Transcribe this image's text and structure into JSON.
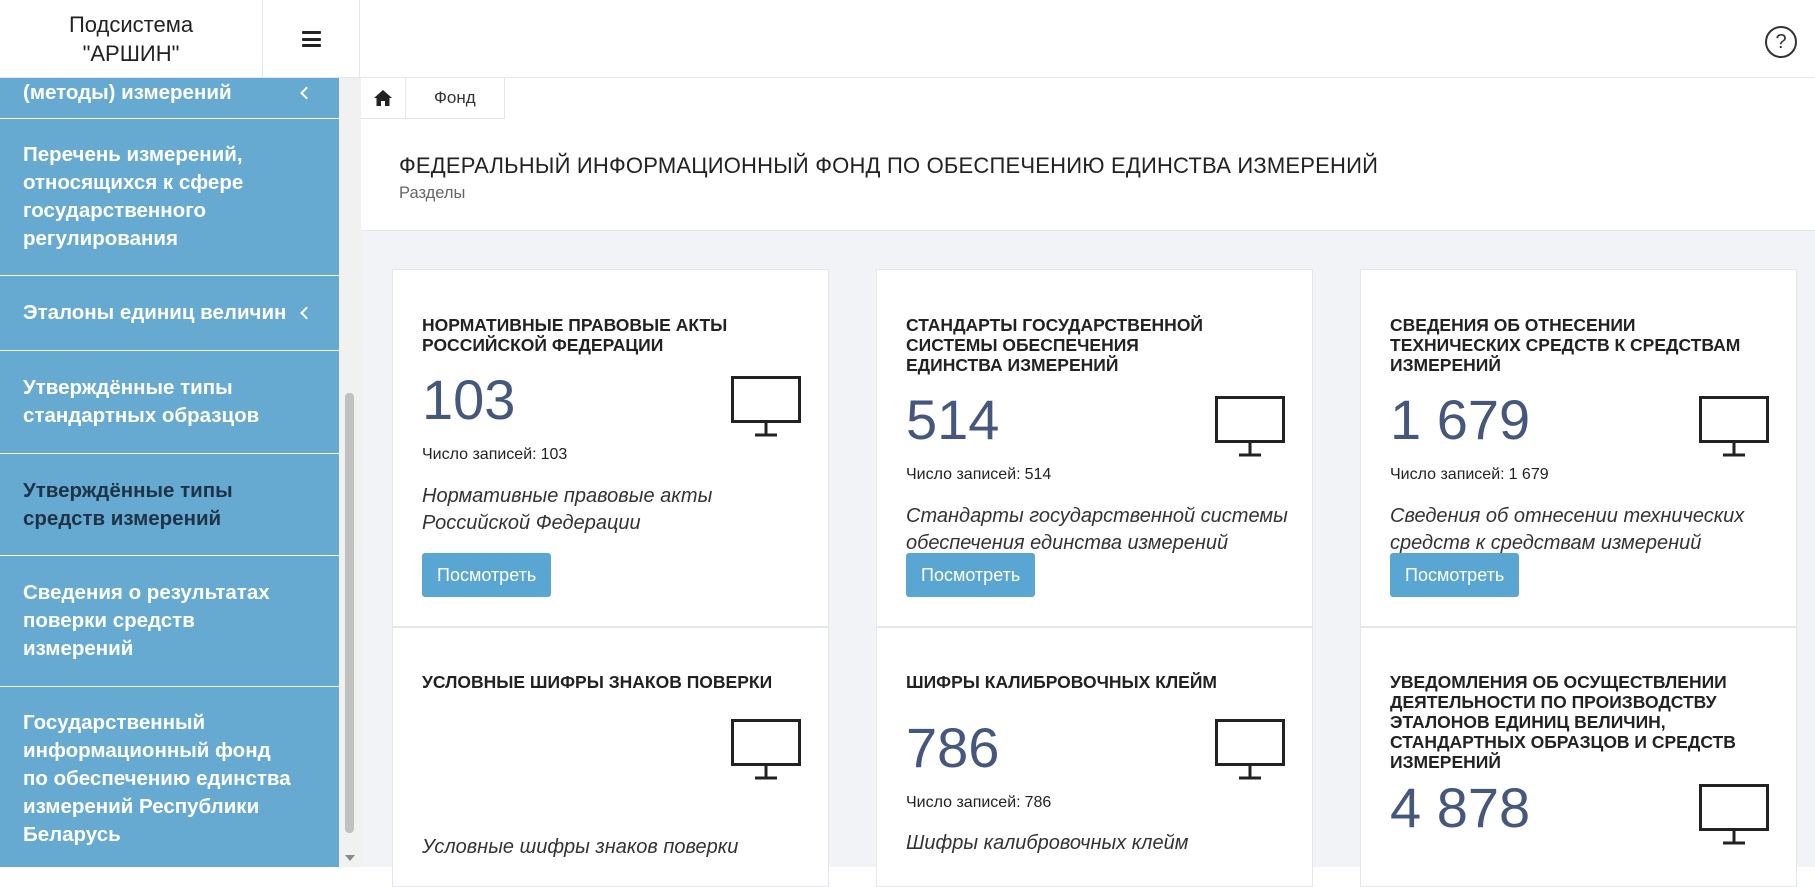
{
  "app": {
    "brand_line1": "Подсистема",
    "brand_line2": "\"АРШИН\"",
    "help_label": "?"
  },
  "sidebar": {
    "items": [
      {
        "label": "(методы) измерений",
        "has_chevron": true
      },
      {
        "label": "Перечень измерений, относящихся к сфере государственного регулирования",
        "has_chevron": false
      },
      {
        "label": "Эталоны единиц величин",
        "has_chevron": true
      },
      {
        "label": "Утверждённые типы стандартных образцов",
        "has_chevron": false
      },
      {
        "label": "Утверждённые типы средств измерений",
        "has_chevron": false,
        "active": true
      },
      {
        "label": "Сведения о результатах поверки средств измерений",
        "has_chevron": false
      },
      {
        "label": "Государственный информационный фонд по обеспечению единства измерений Республики Беларусь",
        "has_chevron": false
      }
    ],
    "colors": {
      "background": "#66aad2",
      "active_text": "#1f3346"
    }
  },
  "breadcrumb": {
    "home_icon": "home-icon",
    "current": "Фонд"
  },
  "header": {
    "title": "ФЕДЕРАЛЬНЫЙ ИНФОРМАЦИОННЫЙ ФОНД ПО ОБЕСПЕЧЕНИЮ ЕДИНСТВА ИЗМЕРЕНИЙ",
    "subtitle": "Разделы"
  },
  "cards": [
    {
      "title": "НОРМАТИВНЫЕ ПРАВОВЫЕ АКТЫ РОССИЙСКОЙ ФЕДЕРАЦИИ",
      "count": "103",
      "records_label": "Число записей:",
      "records_value": "103",
      "description": "Нормативные правовые акты Российской Федерации",
      "button": "Посмотреть",
      "icon": "monitor-icon"
    },
    {
      "title": "СТАНДАРТЫ ГОСУДАРСТВЕННОЙ СИСТЕМЫ ОБЕСПЕЧЕНИЯ ЕДИНСТВА ИЗМЕРЕНИЙ",
      "count": "514",
      "records_label": "Число записей:",
      "records_value": "514",
      "description": "Стандарты государственной системы обеспечения единства измерений",
      "button": "Посмотреть",
      "icon": "monitor-icon"
    },
    {
      "title": "СВЕДЕНИЯ ОБ ОТНЕСЕНИИ ТЕХНИЧЕСКИХ СРЕДСТВ К СРЕДСТВАМ ИЗМЕРЕНИЙ",
      "count": "1 679",
      "records_label": "Число записей:",
      "records_value": "1 679",
      "description": "Сведения об отнесении технических средств к средствам измерений",
      "button": "Посмотреть",
      "icon": "monitor-icon"
    },
    {
      "title": "УСЛОВНЫЕ ШИФРЫ ЗНАКОВ ПОВЕРКИ",
      "count": "",
      "records_label": "",
      "records_value": "",
      "description": "Условные шифры знаков поверки",
      "button": "",
      "icon": "monitor-icon"
    },
    {
      "title": "ШИФРЫ КАЛИБРОВОЧНЫХ КЛЕЙМ",
      "count": "786",
      "records_label": "Число записей:",
      "records_value": "786",
      "description": "Шифры калибровочных клейм",
      "button": "",
      "icon": "monitor-icon"
    },
    {
      "title": "УВЕДОМЛЕНИЯ ОБ ОСУЩЕСТВЛЕНИИ ДЕЯТЕЛЬНОСТИ ПО ПРОИЗВОДСТВУ ЭТАЛОНОВ ЕДИНИЦ ВЕЛИЧИН, СТАНДАРТНЫХ ОБРАЗЦОВ И СРЕДСТВ ИЗМЕРЕНИЙ",
      "count": "4 878",
      "records_label": "",
      "records_value": "",
      "description": "",
      "button": "",
      "icon": "monitor-icon"
    }
  ],
  "colors": {
    "accent": "#5aa6d3",
    "count_text": "#45577c",
    "main_background": "#f1f3f6"
  }
}
